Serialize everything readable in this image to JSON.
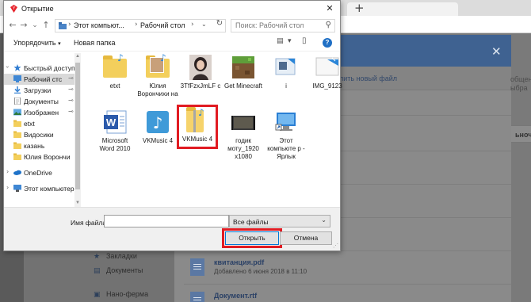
{
  "dialog": {
    "title": "Открытие",
    "close_glyph": "✕",
    "nav": {
      "back": "←",
      "forward": "→",
      "dropdown": "⌄",
      "up": "↑"
    },
    "path": [
      "Этот компьют...",
      "Рабочий стол"
    ],
    "path_sep": "›",
    "refresh_glyph": "↻",
    "search_placeholder": "Поиск: Рабочий стол",
    "search_glyph": "⚲",
    "toolbar": {
      "organize": "Упорядочить",
      "new_folder": "Новая папка",
      "view_glyph": "▤",
      "more_glyph": "▾",
      "help": "?"
    },
    "tree": [
      {
        "label": "Быстрый доступ",
        "icon": "star-icon",
        "pinned": false
      },
      {
        "label": "Рабочий стс",
        "icon": "desktop-icon",
        "pinned": true,
        "selected": true
      },
      {
        "label": "Загрузки",
        "icon": "download-icon",
        "pinned": true
      },
      {
        "label": "Документы",
        "icon": "documents-icon",
        "pinned": true
      },
      {
        "label": "Изображен",
        "icon": "pictures-icon",
        "pinned": true
      },
      {
        "label": "etxt",
        "icon": "folder-icon",
        "pinned": false
      },
      {
        "label": "Видосики",
        "icon": "folder-icon",
        "pinned": false
      },
      {
        "label": "казань",
        "icon": "folder-icon",
        "pinned": false
      },
      {
        "label": "Юлия Ворончи",
        "icon": "folder-icon",
        "pinned": false
      },
      {
        "label": "OneDrive",
        "icon": "onedrive-icon",
        "pinned": false
      },
      {
        "label": "Этот компьютер",
        "icon": "computer-icon",
        "pinned": false
      }
    ],
    "pin_glyph": "⊸",
    "chevron_glyph": "›",
    "files": [
      {
        "label": "etxt",
        "kind": "folder"
      },
      {
        "label": "Юлия Ворончихи на",
        "kind": "photo-folder"
      },
      {
        "label": "3TfFzxJmLF с",
        "kind": "photo"
      },
      {
        "label": "Get Minecraft",
        "kind": "minecraft"
      },
      {
        "label": "i",
        "kind": "shortcut"
      },
      {
        "label": "IMG_9123",
        "kind": "image"
      },
      {
        "label": "Microsoft Word 2010",
        "kind": "word"
      },
      {
        "label": "VKMusic 4",
        "kind": "vkmusic-app"
      },
      {
        "label": "VKMusic 4",
        "kind": "vkmusic-folder",
        "highlighted": true
      },
      {
        "label": "годик моту_1920 x1080",
        "kind": "video"
      },
      {
        "label": "Этот компьюте р - Ярлык",
        "kind": "computer-shortcut"
      }
    ],
    "filename_label": "Имя файла:",
    "filename_value": "",
    "filetype": "Все файлы",
    "open_label": "Открыть",
    "cancel_label": "Отмена"
  },
  "background": {
    "new_tab_glyph": "+",
    "modal_close": "✕",
    "upload_link": "лить новый файл",
    "right_text_1": "общени",
    "right_text_2": "ыбра",
    "right_text_3": "ьноч",
    "nav": [
      {
        "label": "Закладки",
        "glyph": "★"
      },
      {
        "label": "Документы",
        "glyph": "▤"
      },
      {
        "label": "Нано-ферма",
        "glyph": "▣"
      }
    ],
    "files": [
      {
        "name": "квитанция.pdf",
        "date": "Добавлено 6 июня 2018 в 11:10"
      },
      {
        "name": "Документ.rtf",
        "date": ""
      }
    ]
  },
  "colors": {
    "accent_red": "#e11b22",
    "modal_header": "#3f6291",
    "help_blue": "#1f6fc5"
  }
}
